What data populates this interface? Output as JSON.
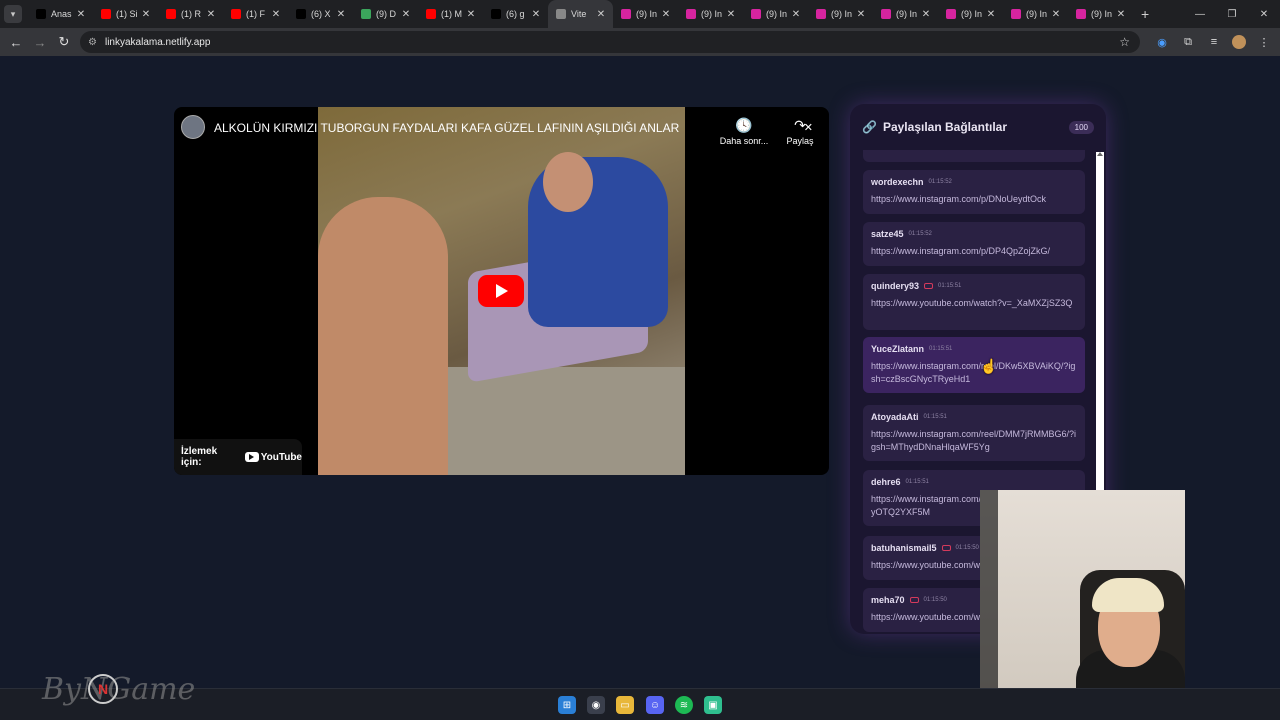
{
  "browser": {
    "tabs": [
      {
        "label": "Anas",
        "icon": "x-icon",
        "color": "#000000"
      },
      {
        "label": "(1) Si",
        "icon": "youtube-icon",
        "color": "#ff0000"
      },
      {
        "label": "(1) R",
        "icon": "youtube-icon",
        "color": "#ff0000"
      },
      {
        "label": "(1) F",
        "icon": "youtube-icon",
        "color": "#ff0000"
      },
      {
        "label": "(6) X",
        "icon": "x-icon",
        "color": "#000000"
      },
      {
        "label": "(9) D",
        "icon": "discord-icon",
        "color": "#3ba55c"
      },
      {
        "label": "(1) M",
        "icon": "youtube-icon",
        "color": "#ff0000"
      },
      {
        "label": "(6) g",
        "icon": "x-icon",
        "color": "#000000"
      },
      {
        "label": "Vite",
        "icon": "globe-icon",
        "color": "#888888",
        "active": true
      },
      {
        "label": "(9) In",
        "icon": "instagram-icon",
        "color": "#d6249f"
      },
      {
        "label": "(9) In",
        "icon": "instagram-icon",
        "color": "#d6249f"
      },
      {
        "label": "(9) In",
        "icon": "instagram-icon",
        "color": "#d6249f"
      },
      {
        "label": "(9) In",
        "icon": "instagram-icon",
        "color": "#d6249f"
      },
      {
        "label": "(9) In",
        "icon": "instagram-icon",
        "color": "#d6249f"
      },
      {
        "label": "(9) In",
        "icon": "instagram-icon",
        "color": "#d6249f"
      },
      {
        "label": "(9) In",
        "icon": "instagram-icon",
        "color": "#d6249f"
      },
      {
        "label": "(9) In",
        "icon": "instagram-icon",
        "color": "#d6249f"
      }
    ],
    "url": "linkyakalama.netlify.app"
  },
  "video": {
    "title": "ALKOLÜN KIRMIZI TUBORGUN FAYDALARI KAFA GÜZEL LAFININ AŞILDIĞI ANLAR",
    "watch_later": "Daha sonr...",
    "share": "Paylaş",
    "watch_on": "İzlemek için:",
    "platform": "YouTube"
  },
  "panel": {
    "title": "Paylaşılan Bağlantılar",
    "count": "100",
    "accent": "#b98ae6",
    "items": [
      {
        "user": "wordexechn",
        "time": "01:15:52",
        "link": "https://www.instagram.com/p/DNoUeydtOck",
        "yt": false
      },
      {
        "user": "satze45",
        "time": "01:15:52",
        "link": "https://www.instagram.com/p/DP4QpZojZkG/",
        "yt": false
      },
      {
        "user": "quindery93",
        "time": "01:15:51",
        "link": "https://www.youtube.com/watch?v=_XaMXZjSZ3Q",
        "yt": true
      },
      {
        "user": "YuceZlatann",
        "time": "01:15:51",
        "link": "https://www.instagram.com/reel/DKw5XBVAiKQ/?igsh=czBscGNycTRyeHd1",
        "yt": false
      },
      {
        "user": "AtoyadaAti",
        "time": "01:15:51",
        "link": "https://www.instagram.com/reel/DMM7jRMMBG6/?igsh=MThydDNnaHlqaWF5Yg",
        "yt": false
      },
      {
        "user": "dehre6",
        "time": "01:15:51",
        "link": "https://www.instagram.com/reel/Dx?igsh=MTVxdmtyOTQ2YXF5M",
        "yt": false
      },
      {
        "user": "batuhanismail5",
        "time": "01:15:50",
        "link": "https://www.youtube.com/watch",
        "yt": true
      },
      {
        "user": "meha70",
        "time": "01:15:50",
        "link": "https://www.youtube.com/watch",
        "yt": true
      }
    ]
  },
  "watermark": "ByNGame"
}
